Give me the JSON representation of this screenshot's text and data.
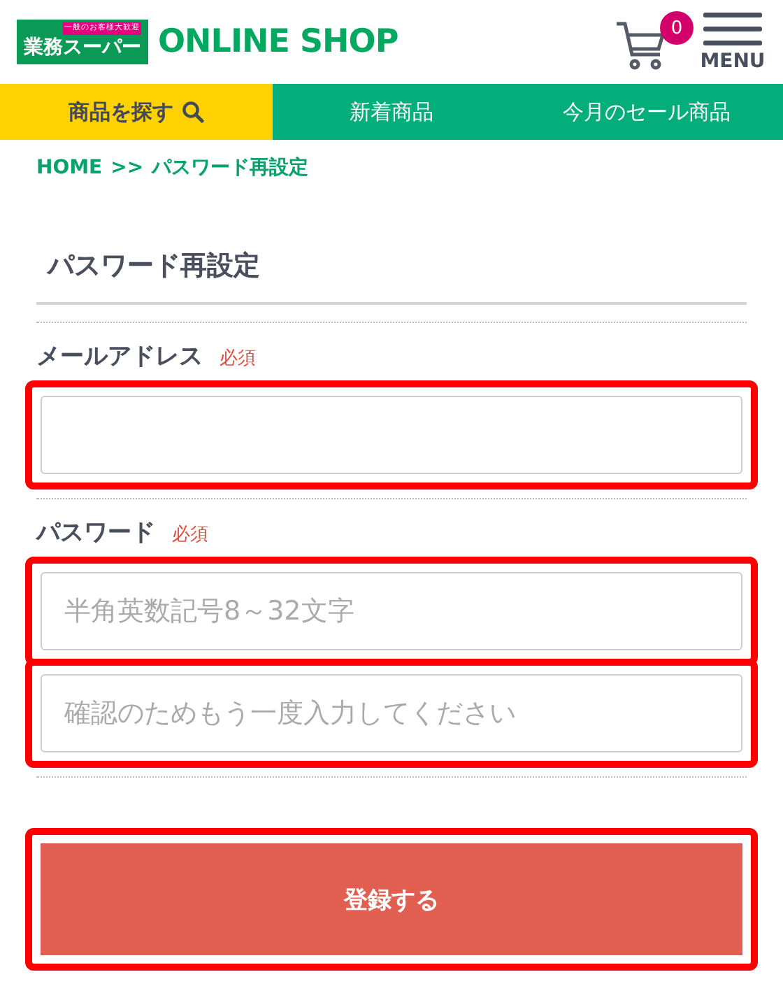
{
  "header": {
    "logo_main": "業務スーパー",
    "logo_banner": "一般のお客様大歓迎",
    "shop_name": "ONLINE SHOP",
    "cart_count": "0",
    "menu_label": "MENU"
  },
  "nav": [
    {
      "label": "商品を探す",
      "kind": "search",
      "selected": true
    },
    {
      "label": "新着商品",
      "kind": "link",
      "selected": false
    },
    {
      "label": "今月のセール商品",
      "kind": "link",
      "selected": false
    }
  ],
  "breadcrumb": {
    "home": "HOME",
    "separator": ">>",
    "current": "パスワード再設定"
  },
  "title": "パスワード再設定",
  "groups": [
    {
      "label": "メールアドレス",
      "required": "必須",
      "fields": [
        {
          "highlighted": true
        }
      ]
    },
    {
      "label": "パスワード",
      "required": "必須",
      "fields": [
        {
          "placeholder": "半角英数記号8～32文字",
          "highlighted": true
        },
        {
          "placeholder": "確認のためもう一度入力してください",
          "highlighted": true
        }
      ]
    }
  ],
  "submit": {
    "label": "登録する",
    "highlighted": true
  }
}
